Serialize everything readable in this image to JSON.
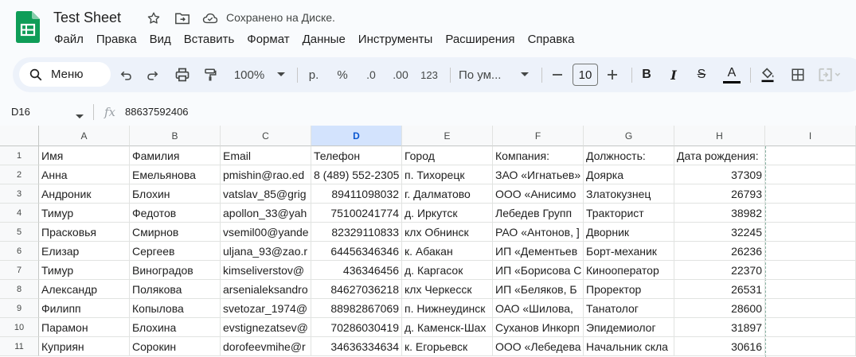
{
  "doc": {
    "title": "Test Sheet",
    "saved_status": "Сохранено на Диске."
  },
  "menu": [
    "Файл",
    "Правка",
    "Вид",
    "Вставить",
    "Формат",
    "Данные",
    "Инструменты",
    "Расширения",
    "Справка"
  ],
  "toolbar": {
    "search_label": "Меню",
    "zoom": "100%",
    "currency": "р.",
    "percent": "%",
    "dec_decrease": ".0",
    "dec_increase": ".00",
    "number_format": "123",
    "font": "По ум...",
    "font_size": "10",
    "bold": "B",
    "italic": "I",
    "strike": "S",
    "text_color": "A"
  },
  "formula_bar": {
    "cell_ref": "D16",
    "fx": "fx",
    "value": "88637592406"
  },
  "columns": [
    "A",
    "B",
    "C",
    "D",
    "E",
    "F",
    "G",
    "H",
    "I"
  ],
  "selected_column": "D",
  "rows": [
    [
      "Имя",
      "Фамилия",
      "Email",
      "Телефон",
      "Город",
      "Компания:",
      "Должность:",
      "Дата рождения:"
    ],
    [
      "Анна",
      "Емельянова",
      "pmishin@rao.ed",
      "8 (489) 552-2305",
      "п. Тихорецк",
      "ЗАО «Игнатьев»",
      "Доярка",
      "37309"
    ],
    [
      "Андроник",
      "Блохин",
      "vatslav_85@grig",
      "89411098032",
      "г. Далматово",
      "ООО «Анисимо",
      "Златокузнец",
      "26793"
    ],
    [
      "Тимур",
      "Федотов",
      "apollon_33@yah",
      "75100241774",
      "д. Иркутск",
      "Лебедев Групп",
      "Тракторист",
      "38982"
    ],
    [
      "Прасковья",
      "Смирнов",
      "vsemil00@yande",
      "82329110833",
      "клх Обнинск",
      "РАО «Антонов, ]",
      "Дворник",
      "32245"
    ],
    [
      "Елизар",
      "Сергеев",
      "uljana_93@zao.r",
      "64456346346",
      "к. Абакан",
      "ИП «Дементьев",
      "Борт-механик",
      "26236"
    ],
    [
      "Тимур",
      "Виноградов",
      "kimseliverstov@",
      "436346456",
      "д. Каргасок",
      "ИП «Борисова С",
      "Кинооператор",
      "22370"
    ],
    [
      "Александр",
      "Полякова",
      "arsenialeksandro",
      "84627036218",
      "клх Черкесск",
      "ИП «Беляков, Б",
      "Проректор",
      "26531"
    ],
    [
      "Филипп",
      "Копылова",
      "svetozar_1974@",
      "88982867069",
      "п. Нижнеудинск",
      "ОАО «Шилова,",
      "Танатолог",
      "28600"
    ],
    [
      "Парамон",
      "Блохина",
      "evstignezatsev@",
      "70286030419",
      "д. Каменск-Шах",
      "Суханов Инкорп",
      "Эпидемиолог",
      "31897"
    ],
    [
      "Куприян",
      "Сорокин",
      "dorofeevmihe@r",
      "34636334634",
      "к. Егорьевск",
      "ООО «Лебедева",
      "Начальник скла",
      "30616"
    ]
  ],
  "row_numbers": [
    "1",
    "2",
    "3",
    "4",
    "5",
    "6",
    "7",
    "8",
    "9",
    "10",
    "11"
  ]
}
